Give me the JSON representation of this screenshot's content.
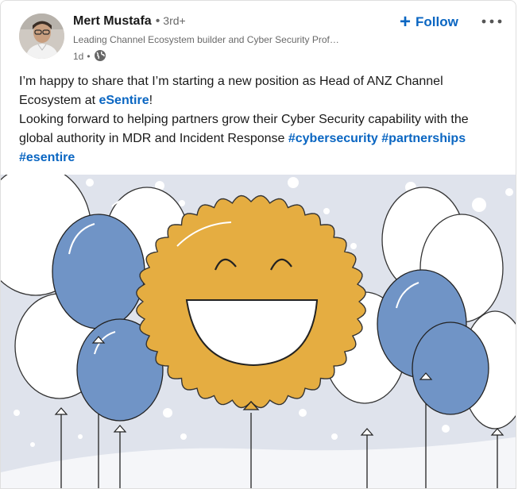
{
  "author": {
    "name": "Mert Mustafa",
    "separator": "•",
    "degree": "3rd+",
    "headline": "Leading Channel Ecosystem builder and Cyber Security Prof…",
    "time": "1d",
    "meta_separator": "•",
    "visibility_icon": "globe-icon"
  },
  "actions": {
    "follow_icon": "plus-icon",
    "follow_plus": "+",
    "follow_label": "Follow",
    "more_icon": "more-options-icon"
  },
  "post": {
    "line1_text": "I’m happy to share that I’m starting a new position as Head of ANZ Channel Ecosystem at ",
    "line1_link": "eSentire",
    "line1_end": "!",
    "line2_text": "Looking forward to helping partners grow their Cyber Security capability with the global authority in MDR and Incident Response ",
    "hashtag1": "#cybersecurity",
    "hashtag2": "#partnerships",
    "hashtag3": "#esentire"
  },
  "image": {
    "subject": "celebration-illustration",
    "colors": {
      "background": "#dfe3ec",
      "balloon_blue": "#7094c6",
      "sun": "#e5ad41"
    }
  },
  "colors": {
    "accent": "#0a66c2",
    "text": "#191919",
    "muted": "#666666"
  }
}
